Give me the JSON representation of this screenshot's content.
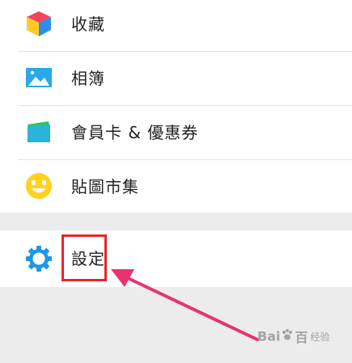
{
  "menu": {
    "items": [
      {
        "label": "收藏",
        "icon": "favorites-cube-icon"
      },
      {
        "label": "相簿",
        "icon": "album-image-icon"
      },
      {
        "label": "會員卡 & 優惠券",
        "icon": "member-card-icon"
      },
      {
        "label": "貼圖市集",
        "icon": "smiley-sticker-icon"
      }
    ],
    "settings": {
      "label": "設定",
      "icon": "gear-icon"
    }
  },
  "annotation": {
    "highlight_color": "#e8232a",
    "arrow_color": "#e8336f"
  },
  "watermark": {
    "brand_a": "Bai",
    "brand_b": "百",
    "site": "经验"
  }
}
